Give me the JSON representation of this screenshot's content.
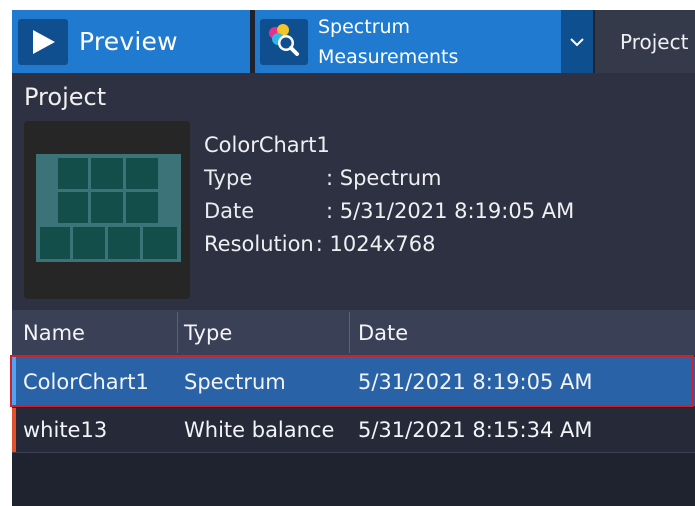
{
  "toolbar": {
    "preview_label": "Preview",
    "spectrum_line1": "Spectrum",
    "spectrum_line2": "Measurements",
    "project_tab_label": "Project"
  },
  "panel": {
    "title": "Project",
    "name": "ColorChart1",
    "type_key": "Type",
    "type_value": ": Spectrum",
    "date_key": "Date",
    "date_value": ": 5/31/2021 8:19:05 AM",
    "resolution_key": "Resolution",
    "resolution_value": ": 1024x768"
  },
  "table": {
    "columns": [
      "Name",
      "Type",
      "Date"
    ],
    "rows": [
      {
        "name": "ColorChart1",
        "type": "Spectrum",
        "date": "5/31/2021 8:19:05 AM",
        "selected": true
      },
      {
        "name": "white13",
        "type": "White balance",
        "date": "5/31/2021 8:15:34 AM",
        "selected": false
      }
    ]
  },
  "icons": {
    "preview": "play-icon",
    "spectrum": "spectrum-search-icon",
    "dropdown": "chevron-down-icon"
  },
  "colors": {
    "accent": "#1f7ad0",
    "selected_row": "#2a62a8",
    "highlight_border": "#d0202a"
  }
}
